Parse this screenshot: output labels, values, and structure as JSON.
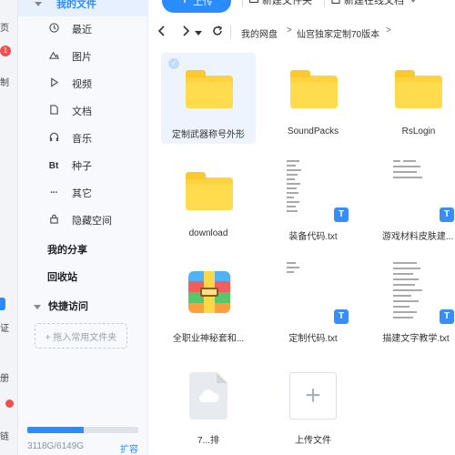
{
  "rail": {
    "labels": [
      "页",
      "制",
      "证",
      "册",
      "链"
    ],
    "badge": "1"
  },
  "sidebar": {
    "my_files": "我的文件",
    "items": [
      {
        "label": "最近",
        "icon": "clock-icon"
      },
      {
        "label": "图片",
        "icon": "image-icon"
      },
      {
        "label": "视频",
        "icon": "video-icon"
      },
      {
        "label": "文档",
        "icon": "document-icon"
      },
      {
        "label": "音乐",
        "icon": "headphones-icon"
      },
      {
        "label": "种子",
        "icon": "bt-icon"
      },
      {
        "label": "其它",
        "icon": "more-icon"
      },
      {
        "label": "隐藏空间",
        "icon": "lock-icon"
      }
    ],
    "my_share": "我的分享",
    "recycle": "回收站",
    "quick_access": "快捷访问",
    "add_common_folder": "+ 拖入常用文件夹",
    "quota_text": "3118G/6149G",
    "quota_fraction": 0.507,
    "expand": "扩容"
  },
  "toolbar": {
    "upload": "上传",
    "new_folder": "新建文件夹",
    "new_online_doc": "新建在线文档"
  },
  "breadcrumb": {
    "root": "我的网盘",
    "current": "仙宫独家定制70版本"
  },
  "files": [
    {
      "name": "定制武器称号外形",
      "type": "folder",
      "selected": true
    },
    {
      "name": "SoundPacks",
      "type": "folder"
    },
    {
      "name": "RsLogin",
      "type": "folder"
    },
    {
      "name": "download",
      "type": "folder"
    },
    {
      "name": "装备代码.txt",
      "type": "txt"
    },
    {
      "name": "游戏材料皮肤建...",
      "type": "txt"
    },
    {
      "name": "全职业神秘套和...",
      "type": "zip"
    },
    {
      "name": "定制代码.txt",
      "type": "txt"
    },
    {
      "name": "描建文字教学.txt",
      "type": "txt"
    },
    {
      "name": "7...排",
      "type": "cloud"
    },
    {
      "name": "上传文件",
      "type": "upload"
    }
  ],
  "colors": {
    "accent": "#2b8cff",
    "folder": "#ffd23e",
    "selected_bg": "#eef4fd",
    "badge_red": "#f24e4e"
  }
}
